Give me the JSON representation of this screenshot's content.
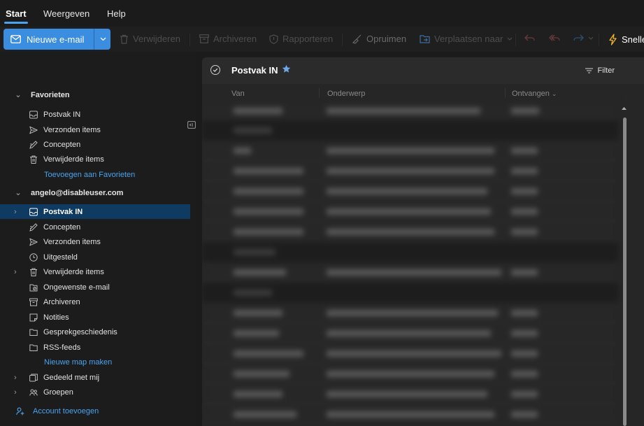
{
  "tabs": [
    {
      "label": "Start",
      "active": true
    },
    {
      "label": "Weergeven",
      "active": false
    },
    {
      "label": "Help",
      "active": false
    }
  ],
  "ribbon": {
    "new_mail": "Nieuwe e-mail",
    "delete": "Verwijderen",
    "archive": "Archiveren",
    "report": "Rapporteren",
    "sweep": "Opruimen",
    "move": "Verplaatsen naar",
    "quick": "Snelle"
  },
  "sidebar": {
    "favorites_title": "Favorieten",
    "favorites": [
      {
        "label": "Postvak IN",
        "icon": "inbox-icon"
      },
      {
        "label": "Verzonden items",
        "icon": "send-icon"
      },
      {
        "label": "Concepten",
        "icon": "draft-icon"
      },
      {
        "label": "Verwijderde items",
        "icon": "trash-icon"
      }
    ],
    "add_favorites": "Toevoegen aan Favorieten",
    "account": "angelo@disableuser.com",
    "folders": [
      {
        "label": "Postvak IN",
        "icon": "inbox-icon",
        "selected": true,
        "expandable": true
      },
      {
        "label": "Concepten",
        "icon": "draft-icon"
      },
      {
        "label": "Verzonden items",
        "icon": "send-icon"
      },
      {
        "label": "Uitgesteld",
        "icon": "clock-icon"
      },
      {
        "label": "Verwijderde items",
        "icon": "trash-icon",
        "expandable": true
      },
      {
        "label": "Ongewenste e-mail",
        "icon": "junk-icon"
      },
      {
        "label": "Archiveren",
        "icon": "archive-icon"
      },
      {
        "label": "Notities",
        "icon": "note-icon"
      },
      {
        "label": "Gesprekgeschiedenis",
        "icon": "folder-icon"
      },
      {
        "label": "RSS-feeds",
        "icon": "folder-icon"
      }
    ],
    "new_folder": "Nieuwe map maken",
    "shared": "Gedeeld met mij",
    "groups": "Groepen",
    "add_account": "Account toevoegen"
  },
  "mail": {
    "folder_title": "Postvak IN",
    "filter": "Filter",
    "columns": {
      "from": "Van",
      "subject": "Onderwerp",
      "received": "Ontvangen"
    }
  },
  "colors": {
    "accent": "#3b8de0",
    "link": "#4aa3f0",
    "selected": "#0f3b62",
    "star": "#6ea8ea"
  }
}
